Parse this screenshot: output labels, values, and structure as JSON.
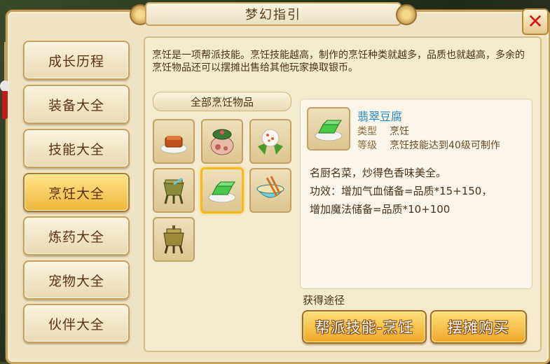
{
  "window": {
    "title": "梦幻指引"
  },
  "sidebar": {
    "items": [
      {
        "label": "成长历程",
        "active": false
      },
      {
        "label": "装备大全",
        "active": false
      },
      {
        "label": "技能大全",
        "active": false
      },
      {
        "label": "烹饪大全",
        "active": true
      },
      {
        "label": "炼药大全",
        "active": false
      },
      {
        "label": "宠物大全",
        "active": false
      },
      {
        "label": "伙伴大全",
        "active": false
      }
    ]
  },
  "intro": "烹饪是一项帮派技能。烹饪技能越高，制作的烹饪种类就越多，品质也就越高，多余的烹饪物品还可以摆摊出售给其他玩家换取银币。",
  "category": {
    "label": "全部烹饪物品"
  },
  "items": [
    {
      "icon": "braised-meat-icon"
    },
    {
      "icon": "peach-jar-icon"
    },
    {
      "icon": "rice-dumpling-icon"
    },
    {
      "icon": "bronze-vessel-icon"
    },
    {
      "icon": "jade-tofu-icon",
      "selected": true
    },
    {
      "icon": "noodle-bowl-icon"
    },
    {
      "icon": "bronze-tripod-icon"
    }
  ],
  "detail": {
    "name": "翡翠豆腐",
    "type_label": "类型",
    "type_value": "烹饪",
    "level_label": "等级",
    "level_value": "烹饪技能达到40级可制作",
    "desc_line1": "名厨名菜，炒得色香味美全。",
    "desc_line2": "功效：增加气血储备=品质*15+150，",
    "desc_line3": "增加魔法储备=品质*10+100"
  },
  "obtain": {
    "label": "获得途径",
    "btn_guild": "帮派技能-烹饪",
    "btn_stall": "摆摊购买"
  },
  "colors": {
    "accent": "#f0b63c",
    "name": "#1e86c8",
    "close": "#d21a1a"
  }
}
